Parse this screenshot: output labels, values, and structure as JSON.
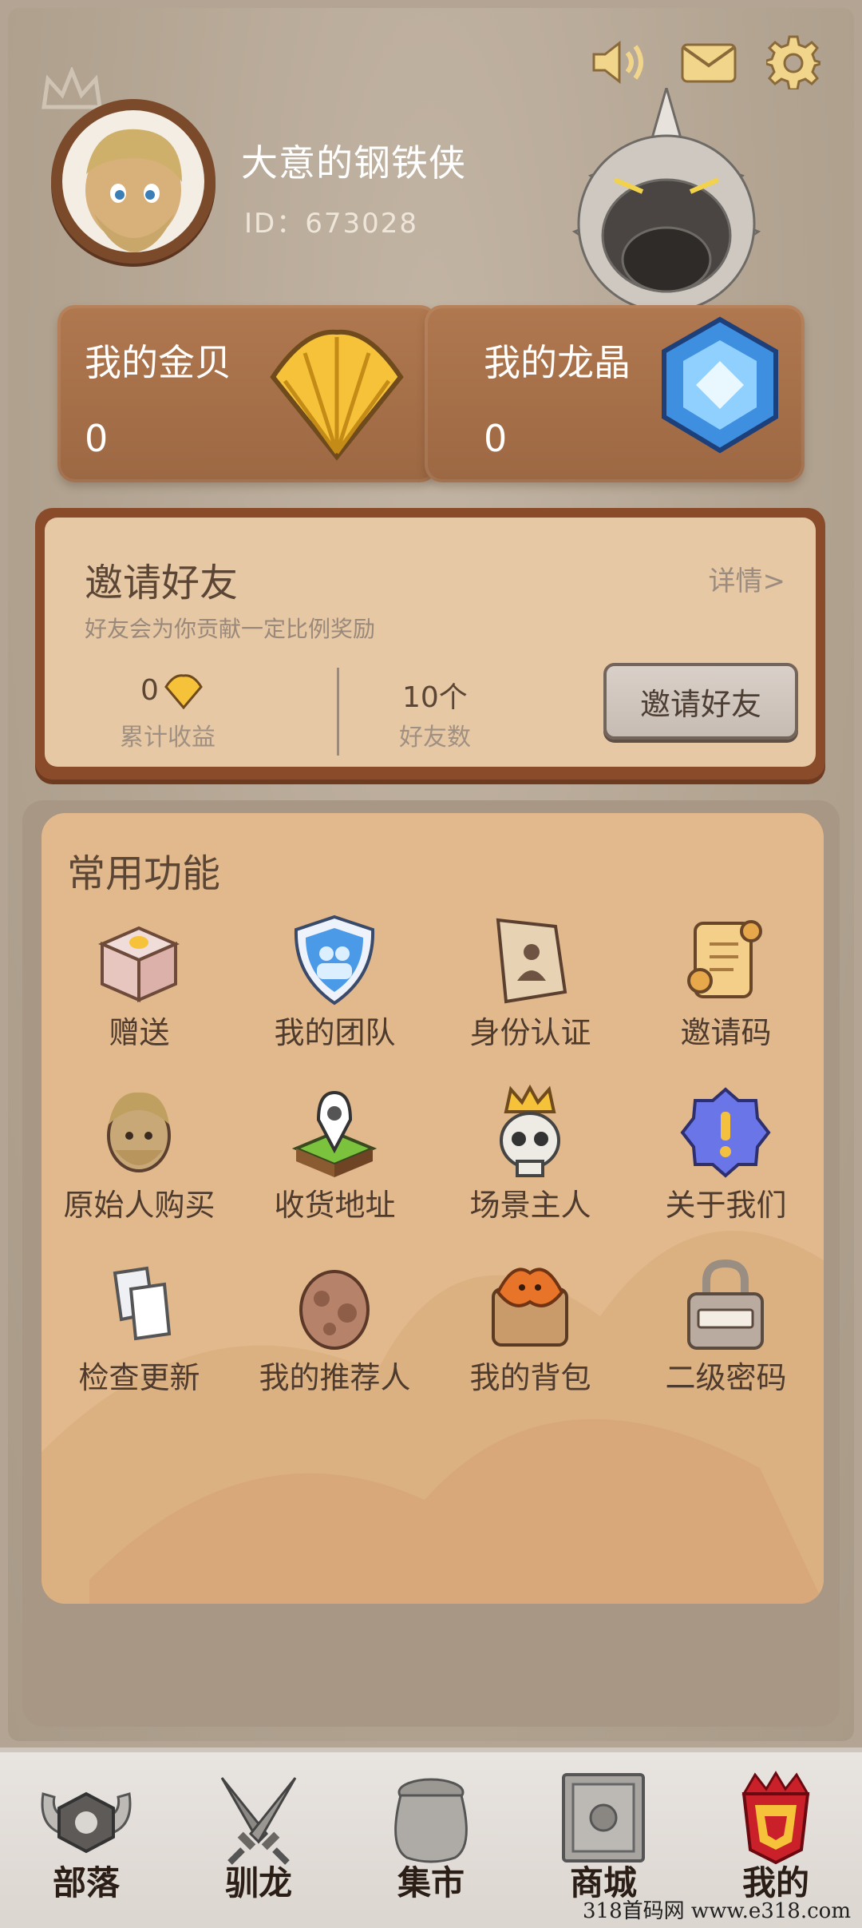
{
  "topbar": {
    "sound_icon": "speaker-icon",
    "mail_icon": "envelope-icon",
    "settings_icon": "gear-icon"
  },
  "profile": {
    "username": "大意的钢铁侠",
    "id_text": "ID：673028"
  },
  "wallet": {
    "gold": {
      "title": "我的金贝",
      "value": "0",
      "icon": "gold-shell-icon"
    },
    "crystal": {
      "title": "我的龙晶",
      "value": "0",
      "icon": "dragon-crystal-icon"
    }
  },
  "invite": {
    "title": "邀请好友",
    "detail": "详情>",
    "subtitle": "好友会为你贡献一定比例奖励",
    "earnings_value": "0",
    "earnings_label": "累计收益",
    "friends_value": "10个",
    "friends_label": "好友数",
    "button": "邀请好友"
  },
  "functions": {
    "title": "常用功能",
    "items": [
      {
        "label": "赠送",
        "icon": "gift-box-icon"
      },
      {
        "label": "我的团队",
        "icon": "team-shield-icon"
      },
      {
        "label": "身份认证",
        "icon": "id-card-icon"
      },
      {
        "label": "邀请码",
        "icon": "scroll-icon"
      },
      {
        "label": "原始人购买",
        "icon": "caveman-icon"
      },
      {
        "label": "收货地址",
        "icon": "location-pin-icon"
      },
      {
        "label": "场景主人",
        "icon": "crowned-skull-icon"
      },
      {
        "label": "关于我们",
        "icon": "info-badge-icon"
      },
      {
        "label": "检查更新",
        "icon": "update-icon"
      },
      {
        "label": "我的推荐人",
        "icon": "dragon-egg-icon"
      },
      {
        "label": "我的背包",
        "icon": "backpack-icon"
      },
      {
        "label": "二级密码",
        "icon": "padlock-icon"
      }
    ]
  },
  "nav": {
    "items": [
      {
        "label": "部落",
        "icon": "tribe-icon"
      },
      {
        "label": "驯龙",
        "icon": "crossed-swords-icon"
      },
      {
        "label": "集市",
        "icon": "sack-icon"
      },
      {
        "label": "商城",
        "icon": "vault-icon"
      },
      {
        "label": "我的",
        "icon": "crown-emblem-icon"
      }
    ]
  },
  "watermark": "318首码网 www.e318.com"
}
